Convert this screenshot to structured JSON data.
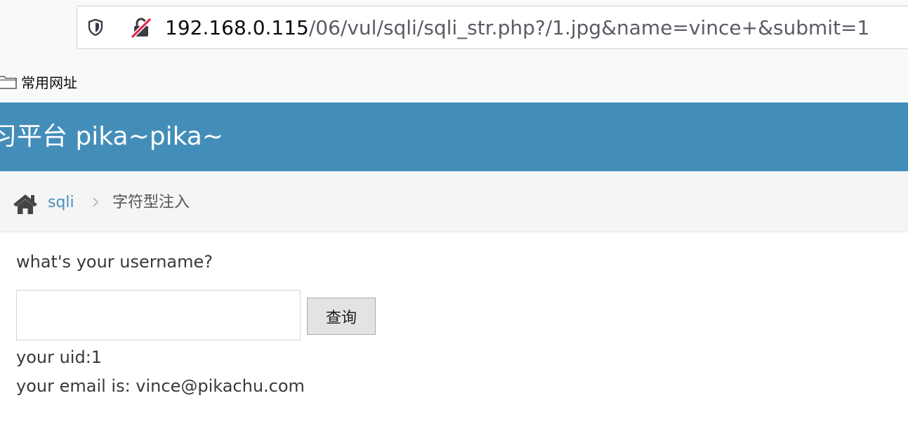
{
  "browser": {
    "url_host": "192.168.0.115",
    "url_path": "/06/vul/sqli/sqli_str.php?/1.jpg&name=vince+&submit=1",
    "bookmark_folder": "常用网址",
    "icons": [
      "shield-icon",
      "insecure-connection-icon",
      "folder-icon"
    ]
  },
  "header": {
    "title": "习平台 pika~pika~",
    "background_color": "#438eb9"
  },
  "breadcrumb": {
    "home_icon": "home-icon",
    "link": "sqli",
    "current": "字符型注入"
  },
  "form": {
    "question": "what's your username?",
    "input_value": "",
    "submit_label": "查询"
  },
  "result": {
    "uid_line": "your uid:1",
    "email_line": "your email is: vince@pikachu.com"
  }
}
